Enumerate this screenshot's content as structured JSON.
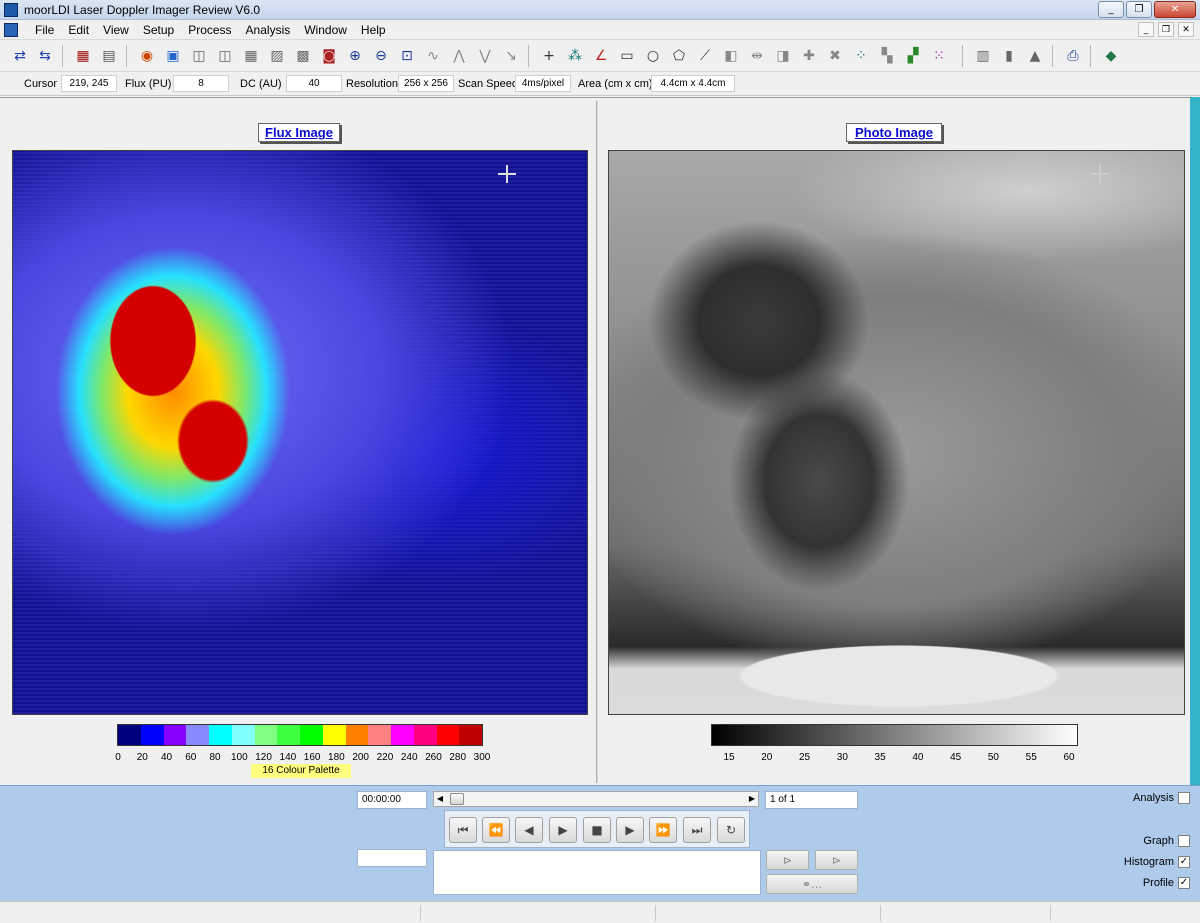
{
  "window": {
    "title": "moorLDI Laser Doppler Imager Review V6.0"
  },
  "menus": [
    "File",
    "Edit",
    "View",
    "Setup",
    "Process",
    "Analysis",
    "Window",
    "Help"
  ],
  "status": {
    "cursor_label": "Cursor",
    "cursor_value": "219, 245",
    "flux_label": "Flux (PU)",
    "flux_value": "8",
    "dc_label": "DC (AU)",
    "dc_value": "40",
    "resolution_label": "Resolution",
    "resolution_value": "256 x 256",
    "scan_label": "Scan Speed",
    "scan_value": "4ms/pixel",
    "area_label": "Area (cm x cm)",
    "area_value": "4.4cm x 4.4cm"
  },
  "flux_panel": {
    "title": "Flux Image",
    "palette_name": "16 Colour Palette",
    "palette_colors": [
      "#000080",
      "#0000ff",
      "#8800ff",
      "#8888ff",
      "#00ffff",
      "#80ffff",
      "#80ff80",
      "#40ff40",
      "#00ff00",
      "#ffff00",
      "#ff8000",
      "#ff8080",
      "#ff00ff",
      "#ff0080",
      "#ff0000",
      "#c00000"
    ],
    "ticks": [
      "0",
      "20",
      "40",
      "60",
      "80",
      "100",
      "120",
      "140",
      "160",
      "180",
      "200",
      "220",
      "240",
      "260",
      "280",
      "300"
    ]
  },
  "photo_panel": {
    "title": "Photo Image",
    "ticks": [
      "15",
      "20",
      "25",
      "30",
      "35",
      "40",
      "45",
      "50",
      "55",
      "60"
    ]
  },
  "playback": {
    "time": "00:00:00",
    "frame": "1 of 1"
  },
  "options": {
    "analysis": {
      "label": "Analysis",
      "checked": false
    },
    "graph": {
      "label": "Graph",
      "checked": false
    },
    "histogram": {
      "label": "Histogram",
      "checked": true
    },
    "profile": {
      "label": "Profile",
      "checked": true
    }
  }
}
